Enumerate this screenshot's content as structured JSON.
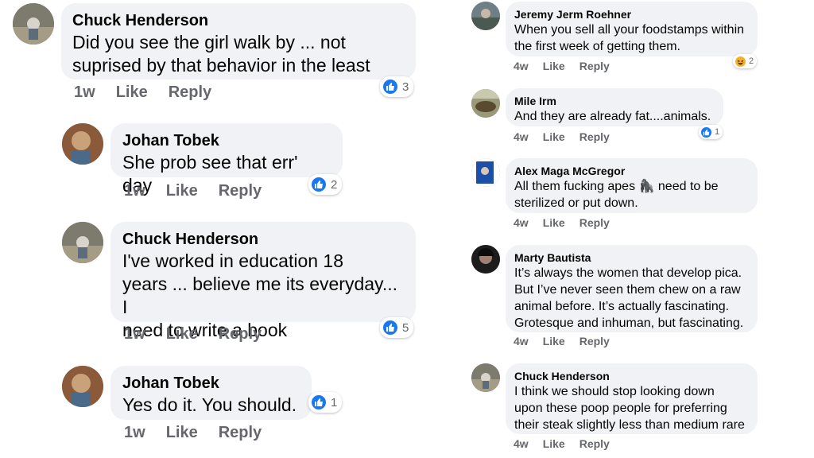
{
  "left_comments": [
    {
      "name": "Chuck Henderson",
      "text": "Did you see the girl walk by ... not\nsuprised by that behavior in the least",
      "time": "1w",
      "like": "Like",
      "reply": "Reply",
      "reaction_count": "3"
    },
    {
      "name": "Johan Tobek",
      "text": "She prob see that err' day",
      "time": "1w",
      "like": "Like",
      "reply": "Reply",
      "reaction_count": "2"
    },
    {
      "name": "Chuck Henderson",
      "text": "I've worked in education 18\nyears ... believe me its everyday... I\nneed to write a book",
      "time": "1w",
      "like": "Like",
      "reply": "Reply",
      "reaction_count": "5"
    },
    {
      "name": "Johan Tobek",
      "text": "Yes do it. You should.",
      "time": "1w",
      "like": "Like",
      "reply": "Reply",
      "reaction_count": "1"
    }
  ],
  "right_comments": [
    {
      "name": "Jeremy Jerm Roehner",
      "text": "When you sell all your foodstamps within\nthe first week of getting them.",
      "time": "4w",
      "like": "Like",
      "reply": "Reply",
      "reaction_count": "2",
      "reaction_type": "haha"
    },
    {
      "name": "Mile Irm",
      "text": "And they are already fat....animals.",
      "time": "4w",
      "like": "Like",
      "reply": "Reply",
      "reaction_count": "1",
      "reaction_type": "like"
    },
    {
      "name": "Alex Maga McGregor",
      "text_before": "All them fucking apes ",
      "emoji": "🦍",
      "text_after": " need to be\nsterilized or put down.",
      "time": "4w",
      "like": "Like",
      "reply": "Reply"
    },
    {
      "name": "Marty Bautista",
      "text": "It’s always the women that develop pica.\nBut I’ve never seen them chew on a raw\nanimal before. It’s actually fascinating.\nGrotesque and inhuman, but fascinating.",
      "time": "4w",
      "like": "Like",
      "reply": "Reply"
    },
    {
      "name": "Chuck Henderson",
      "text": "I think we should stop looking down\nupon these poop people for preferring\ntheir steak slightly less than medium rare",
      "time": "4w",
      "like": "Like",
      "reply": "Reply"
    }
  ],
  "colors": {
    "bubble": "#f0f2f5",
    "meta": "#65676b",
    "like_blue": "#1877f2",
    "haha_yellow": "#f7b125"
  }
}
